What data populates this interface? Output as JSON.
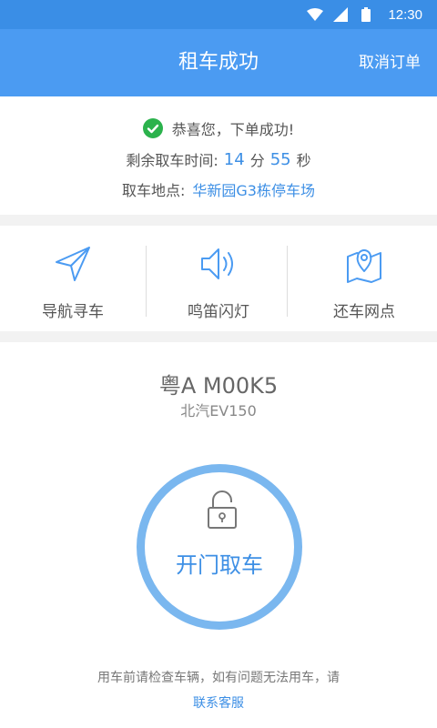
{
  "status_bar": {
    "time": "12:30",
    "icons": [
      "wifi-icon",
      "signal-icon",
      "battery-icon"
    ]
  },
  "header": {
    "title": "租车成功",
    "cancel_label": "取消订单"
  },
  "order": {
    "success_message": "恭喜您，下单成功!",
    "remaining_label": "剩余取车时间:",
    "minutes": "14",
    "minutes_unit": "分",
    "seconds": "55",
    "seconds_unit": "秒",
    "location_label": "取车地点:",
    "location_value": "华新园G3栋停车场"
  },
  "actions": [
    {
      "label": "导航寻车",
      "icon": "navigation-icon"
    },
    {
      "label": "鸣笛闪灯",
      "icon": "speaker-icon"
    },
    {
      "label": "还车网点",
      "icon": "map-pin-icon"
    }
  ],
  "car": {
    "plate": "粤A M00K5",
    "model": "北汽EV150"
  },
  "unlock": {
    "label": "开门取车",
    "icon": "unlock-icon"
  },
  "footer": {
    "note": "用车前请检查车辆，如有问题无法用车，请",
    "link": "联系客服"
  },
  "colors": {
    "primary": "#4b9bf2",
    "status_bar": "#3a8ee6",
    "accent_text": "#3d8fe5",
    "success": "#2bb24c",
    "ring": "#7ab7ef"
  }
}
